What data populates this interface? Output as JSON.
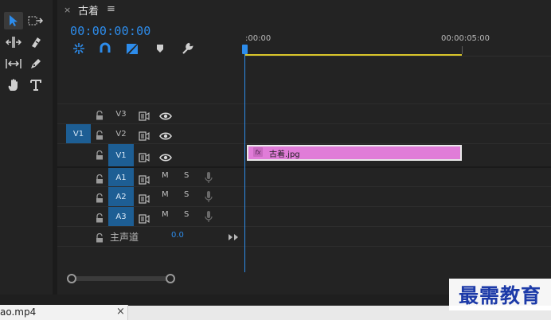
{
  "tools": {
    "items": [
      {
        "name": "selection-tool",
        "active": true
      },
      {
        "name": "track-select-tool",
        "active": false
      },
      {
        "name": "ripple-edit-tool",
        "active": false
      },
      {
        "name": "razor-tool",
        "active": false
      },
      {
        "name": "slip-tool",
        "active": false
      },
      {
        "name": "pen-tool",
        "active": false
      },
      {
        "name": "hand-tool",
        "active": false
      },
      {
        "name": "type-tool",
        "active": false
      }
    ]
  },
  "timeline": {
    "tab_title": "古着",
    "tab_close": "×",
    "tab_menu": "≡",
    "timecode": "00:00:00:00",
    "ruler": {
      "start_label": ":00:00",
      "end_label": "00:00:05:00"
    },
    "accent_color": "#2d8ceb",
    "work_area_color": "#d9c62a",
    "tracks": {
      "video": [
        {
          "source": "",
          "target": "V3",
          "target_on": false
        },
        {
          "source": "V1",
          "target": "V2",
          "target_on": false
        },
        {
          "source": "",
          "target": "V1",
          "target_on": true
        }
      ],
      "audio": [
        {
          "target": "A1",
          "mute": "M",
          "solo": "S"
        },
        {
          "target": "A2",
          "mute": "M",
          "solo": "S"
        },
        {
          "target": "A3",
          "mute": "M",
          "solo": "S"
        }
      ],
      "master": {
        "label": "主声道",
        "value": "0.0"
      }
    },
    "clip": {
      "name": "古着.jpg",
      "fx": "fx",
      "color": "#e07cd8"
    }
  },
  "bottom": {
    "tab_label": "ao.mp4",
    "tab_close": "×"
  },
  "watermark": "最需教育"
}
